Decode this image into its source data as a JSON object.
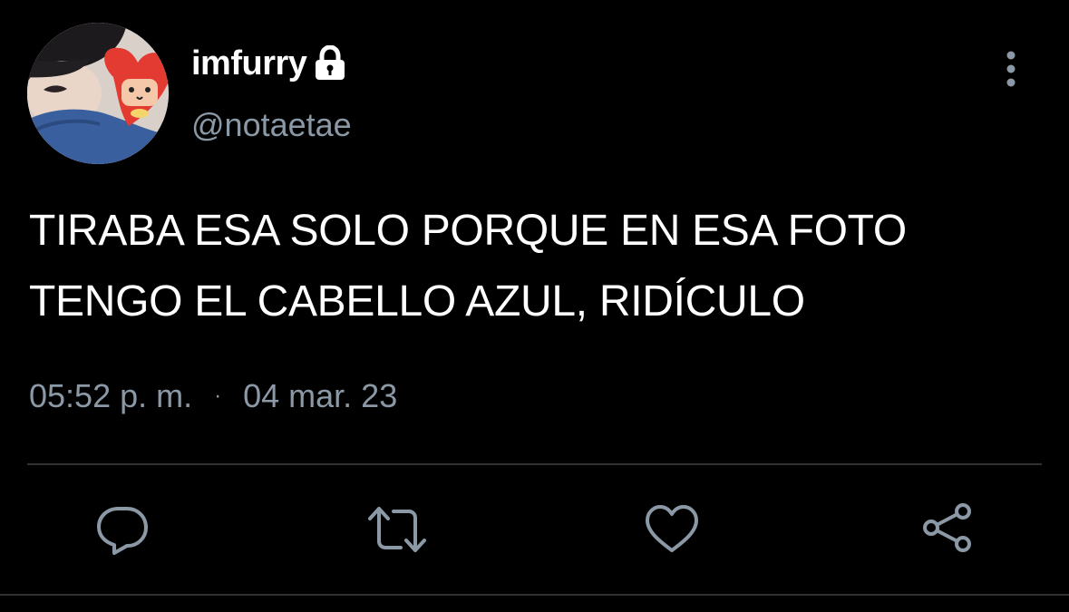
{
  "user": {
    "display_name": "imfurry",
    "handle": "@notaetae",
    "protected_icon": "lock-icon",
    "avatar_icon": "profile-photo"
  },
  "tweet": {
    "text_line1": "TIRABA ESA SOLO PORQUE EN ESA FOTO",
    "text_line2": "TENGO EL CABELLO AZUL, RIDÍCULO",
    "time": "05:52 p. m.",
    "separator": "·",
    "date": "04 mar. 23"
  },
  "actions": {
    "reply_icon": "reply-icon",
    "retweet_icon": "retweet-icon",
    "like_icon": "heart-icon",
    "share_icon": "share-icon",
    "more_icon": "more-vertical-icon"
  },
  "colors": {
    "background": "#000000",
    "primary_text": "#ffffff",
    "secondary_text": "#8b98a5",
    "divider": "#2f3336",
    "icon": "#8b98a5"
  }
}
